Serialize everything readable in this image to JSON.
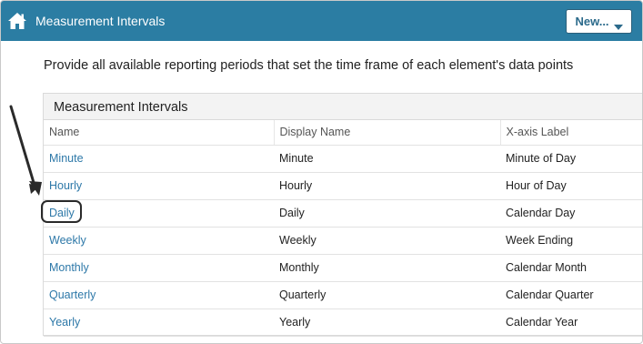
{
  "header": {
    "title": "Measurement Intervals",
    "new_button_label": "New..."
  },
  "description": "Provide all available reporting periods that set the time frame of each element's data points",
  "panel": {
    "title": "Measurement Intervals",
    "columns": [
      "Name",
      "Display Name",
      "X-axis Label"
    ],
    "rows": [
      {
        "name": "Minute",
        "display_name": "Minute",
        "x_axis_label": "Minute of Day"
      },
      {
        "name": "Hourly",
        "display_name": "Hourly",
        "x_axis_label": "Hour of Day"
      },
      {
        "name": "Daily",
        "display_name": "Daily",
        "x_axis_label": "Calendar Day"
      },
      {
        "name": "Weekly",
        "display_name": "Weekly",
        "x_axis_label": "Week Ending"
      },
      {
        "name": "Monthly",
        "display_name": "Monthly",
        "x_axis_label": "Calendar Month"
      },
      {
        "name": "Quarterly",
        "display_name": "Quarterly",
        "x_axis_label": "Calendar Quarter"
      },
      {
        "name": "Yearly",
        "display_name": "Yearly",
        "x_axis_label": "Calendar Year"
      }
    ]
  },
  "icons": {
    "home": "home-icon",
    "caret": "caret-down-icon",
    "annotation_arrow": "arrow-annotation"
  },
  "colors": {
    "topbar": "#2b7da3",
    "link": "#2d78a8",
    "panel_header_bg": "#f3f3f3"
  }
}
